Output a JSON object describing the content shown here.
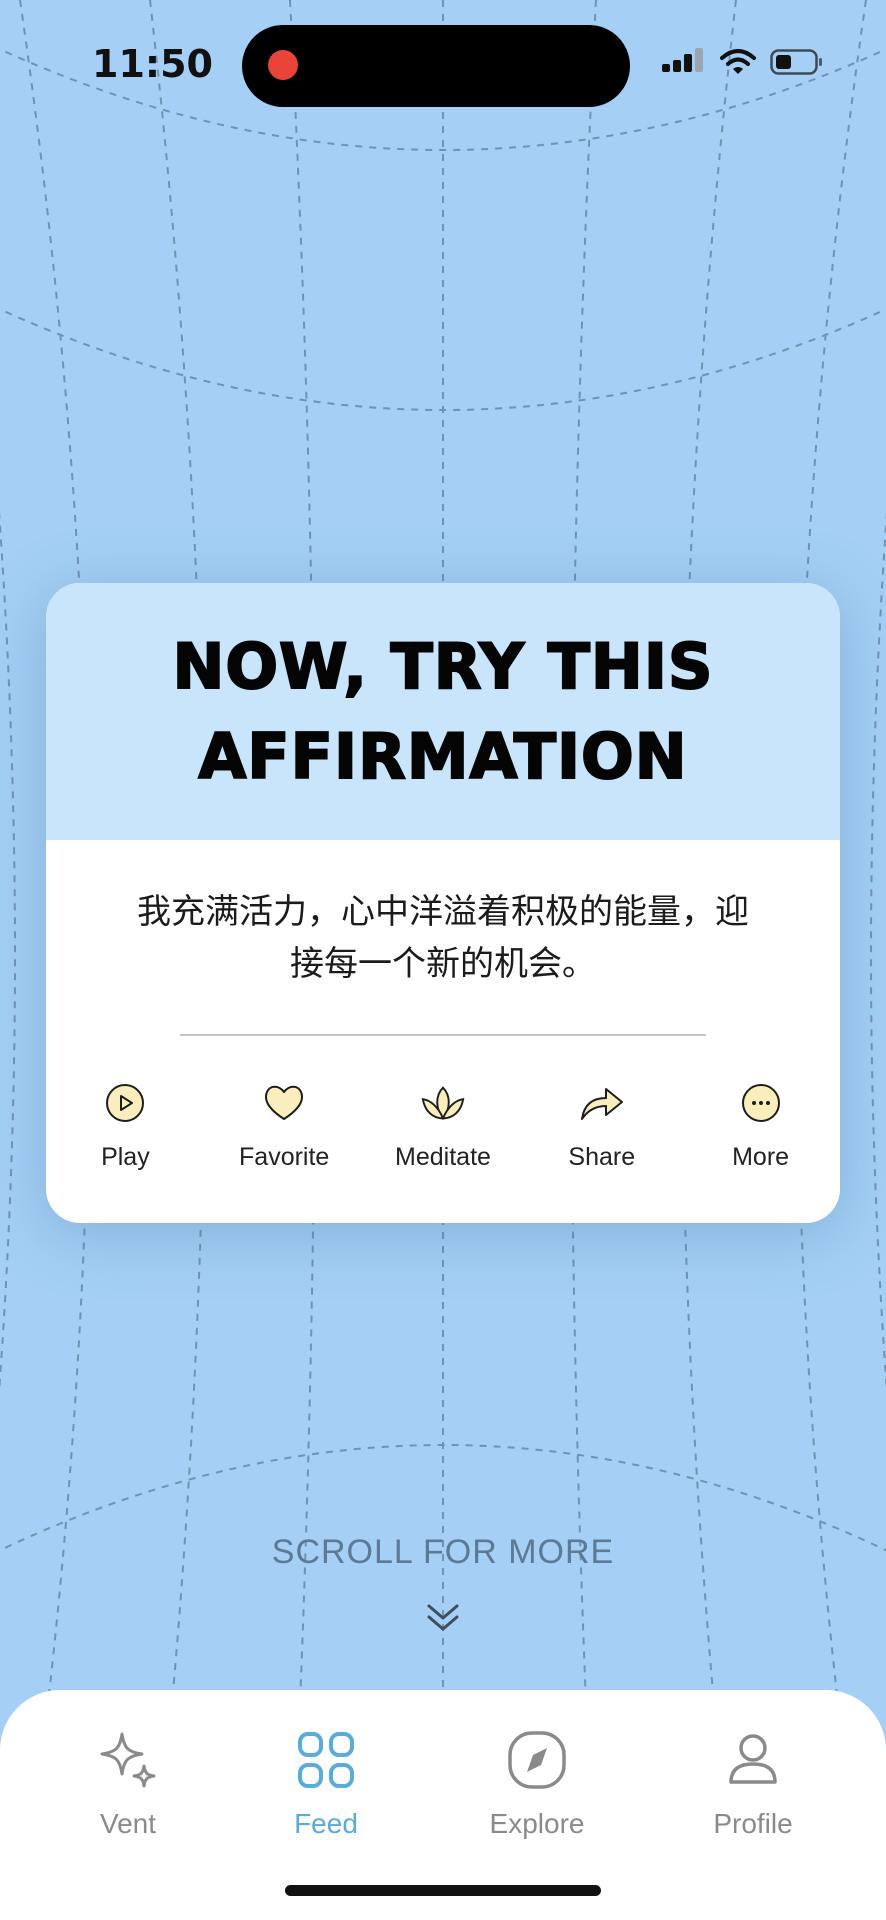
{
  "status_bar": {
    "time": "11:50",
    "icons": [
      "signal-icon",
      "wifi-icon",
      "battery-icon"
    ]
  },
  "card": {
    "title_line1": "NOW, TRY THIS",
    "title_line2": "AFFIRMATION",
    "affirmation_line1": "我充满活力，心中洋溢着积极的能量，迎",
    "affirmation_line2": "接每一个新的机会。",
    "actions": [
      {
        "label": "Play",
        "icon": "play-icon"
      },
      {
        "label": "Favorite",
        "icon": "heart-icon"
      },
      {
        "label": "Meditate",
        "icon": "lotus-icon"
      },
      {
        "label": "Share",
        "icon": "share-icon"
      },
      {
        "label": "More",
        "icon": "more-icon"
      }
    ]
  },
  "scroll_hint": {
    "label": "SCROLL FOR MORE"
  },
  "tabbar": {
    "tabs": [
      {
        "label": "Vent",
        "icon": "sparkle-icon",
        "active": false
      },
      {
        "label": "Feed",
        "icon": "grid-icon",
        "active": true
      },
      {
        "label": "Explore",
        "icon": "compass-icon",
        "active": false
      },
      {
        "label": "Profile",
        "icon": "person-icon",
        "active": false
      }
    ]
  },
  "colors": {
    "background": "#a5cff4",
    "card_header": "#c9e5fb",
    "icon_fill": "#fbeebd",
    "active_tab": "#5aabd8"
  }
}
